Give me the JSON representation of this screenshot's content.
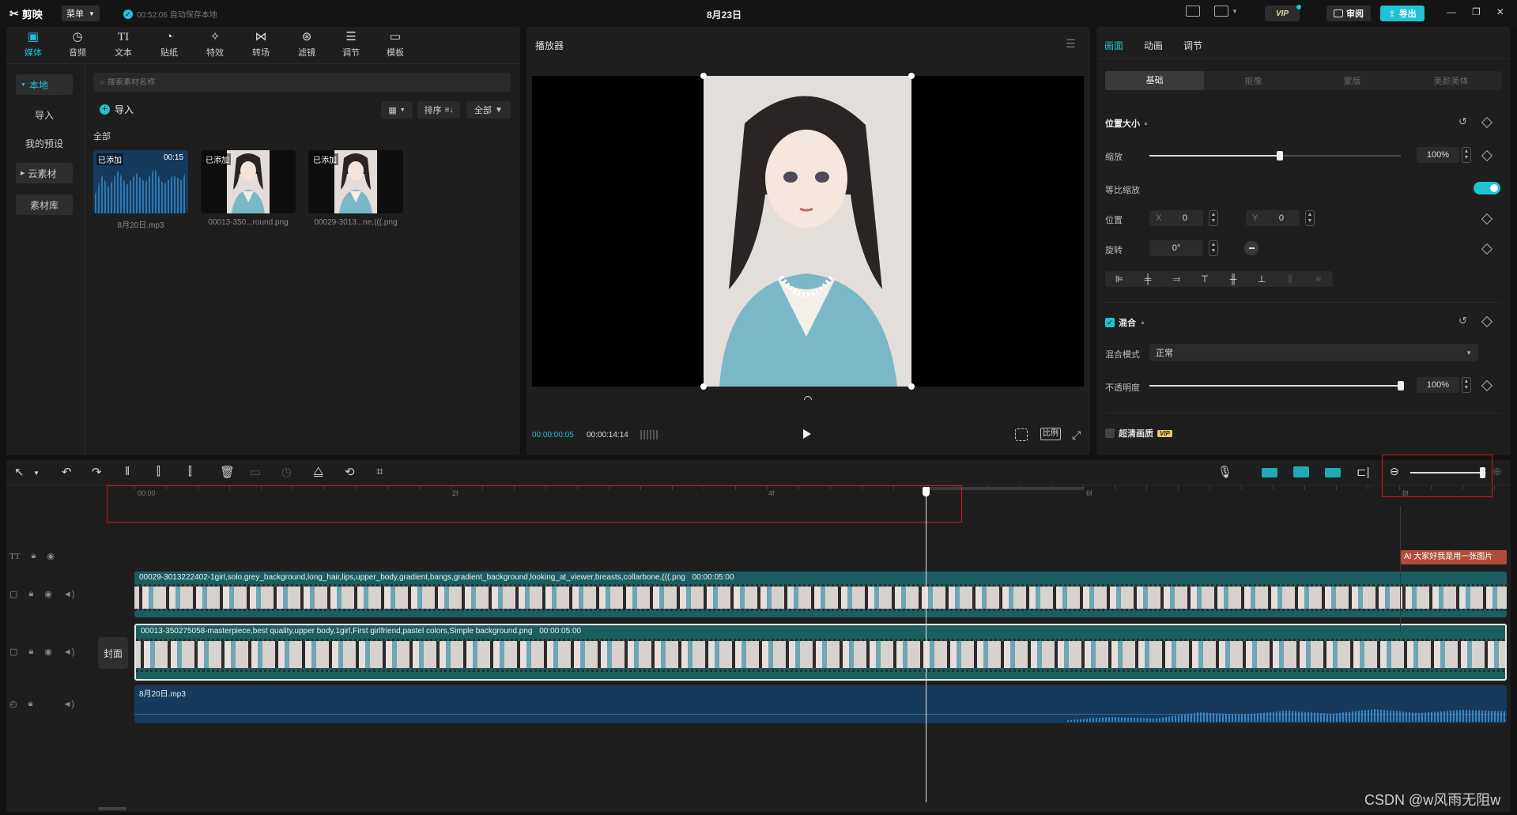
{
  "titlebar": {
    "app_name": "剪映",
    "menu_label": "菜单",
    "autosave": "00:52:06 自动保存本地",
    "project_title": "8月23日",
    "vip_label": "VIP",
    "review_label": "审阅",
    "export_label": "导出"
  },
  "media_tabs": [
    {
      "label": "媒体",
      "icon": "media-icon"
    },
    {
      "label": "音频",
      "icon": "audio-icon"
    },
    {
      "label": "文本",
      "icon": "text-icon",
      "glyph": "TI"
    },
    {
      "label": "贴纸",
      "icon": "sticker-icon"
    },
    {
      "label": "特效",
      "icon": "effects-icon"
    },
    {
      "label": "转场",
      "icon": "transition-icon"
    },
    {
      "label": "滤镜",
      "icon": "filter-icon"
    },
    {
      "label": "调节",
      "icon": "adjust-icon"
    },
    {
      "label": "模板",
      "icon": "template-icon"
    }
  ],
  "sidebar": {
    "items": [
      {
        "label": "本地"
      },
      {
        "label": "导入"
      },
      {
        "label": "我的预设"
      },
      {
        "label": "云素材"
      },
      {
        "label": "素材库"
      }
    ]
  },
  "library": {
    "search_placeholder": "搜索素材名称",
    "import_label": "导入",
    "sort_label": "排序",
    "filter_label": "全部",
    "section_label": "全部",
    "items": [
      {
        "badge": "已添加",
        "duration": "00:15",
        "name": "8月20日.mp3"
      },
      {
        "badge": "已添加",
        "duration": "",
        "name": "00013-350...round.png"
      },
      {
        "badge": "已添加",
        "duration": "",
        "name": "00029-3013...ne,(((.png"
      }
    ]
  },
  "player": {
    "title": "播放器",
    "current_time": "00:00:00:05",
    "total_time": "00:00:14:14",
    "ratio_label": "比例"
  },
  "properties": {
    "tabs": [
      {
        "label": "画面"
      },
      {
        "label": "动画"
      },
      {
        "label": "调节"
      }
    ],
    "subtabs": [
      {
        "label": "基础"
      },
      {
        "label": "抠像"
      },
      {
        "label": "蒙版"
      },
      {
        "label": "美颜美体"
      }
    ],
    "position_size": "位置大小",
    "scale_label": "缩放",
    "scale_value": "100%",
    "scale_fraction": 0.52,
    "uniform_scale": "等比缩放",
    "position_label": "位置",
    "pos_x_label": "X",
    "pos_x": "0",
    "pos_y_label": "Y",
    "pos_y": "0",
    "rotate_label": "旋转",
    "rotate_value": "0°",
    "blend_label": "混合",
    "blend_mode_label": "混合模式",
    "blend_mode_value": "正常",
    "opacity_label": "不透明度",
    "opacity_value": "100%",
    "opacity_fraction": 1.0,
    "hd_label": "超清画质",
    "hd_badge": "VIP"
  },
  "timeline": {
    "ruler": [
      "00:00",
      "2f",
      "4f",
      "6f",
      "8f"
    ],
    "cover_label": "封面",
    "text_clip": "AI 大家好我是用一张图片",
    "video_clip_1": "00029-3013222402-1girl,solo,grey_background,long_hair,lips,upper_body,gradient,bangs,gradient_background,looking_at_viewer,breasts,collarbone,(((.png",
    "video_clip_1_duration": "00:00:05:00",
    "video_clip_2": "00013-350275058-masterpiece,best quality,upper body,1girl,First girlfriend,pastel colors,Simple background.png",
    "video_clip_2_duration": "00:00:05:00",
    "audio_clip": "8月20日.mp3",
    "zoom_fraction": 0.95
  },
  "watermark": "CSDN @w风雨无阻w",
  "colors": {
    "accent": "#1ec3d5",
    "highlight_box": "#c91c1c",
    "video_track": "#1a5e60",
    "audio_track": "#153a5c"
  }
}
